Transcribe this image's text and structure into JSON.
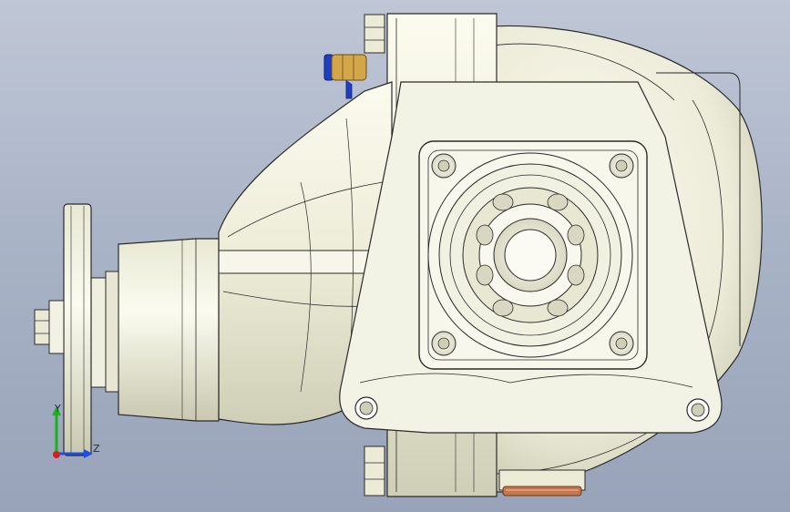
{
  "viewport": {
    "background_top": "#bfc7d6",
    "background_bottom": "#98a3b9"
  },
  "model": {
    "description_icon": "differential-housing-3d-model",
    "body_color": "#f1f1e1",
    "shade_color": "#d4d4bc",
    "edge_color": "#2a2a2a",
    "fitting_color": "#d4a64a",
    "fitting_accent": "#1f3fbf",
    "seal_color": "#c5774b"
  },
  "triad": {
    "y_label": "Y",
    "z_label": "Z",
    "y_color": "#19b319",
    "z_color": "#1f4fe0",
    "x_color": "#d62020"
  }
}
